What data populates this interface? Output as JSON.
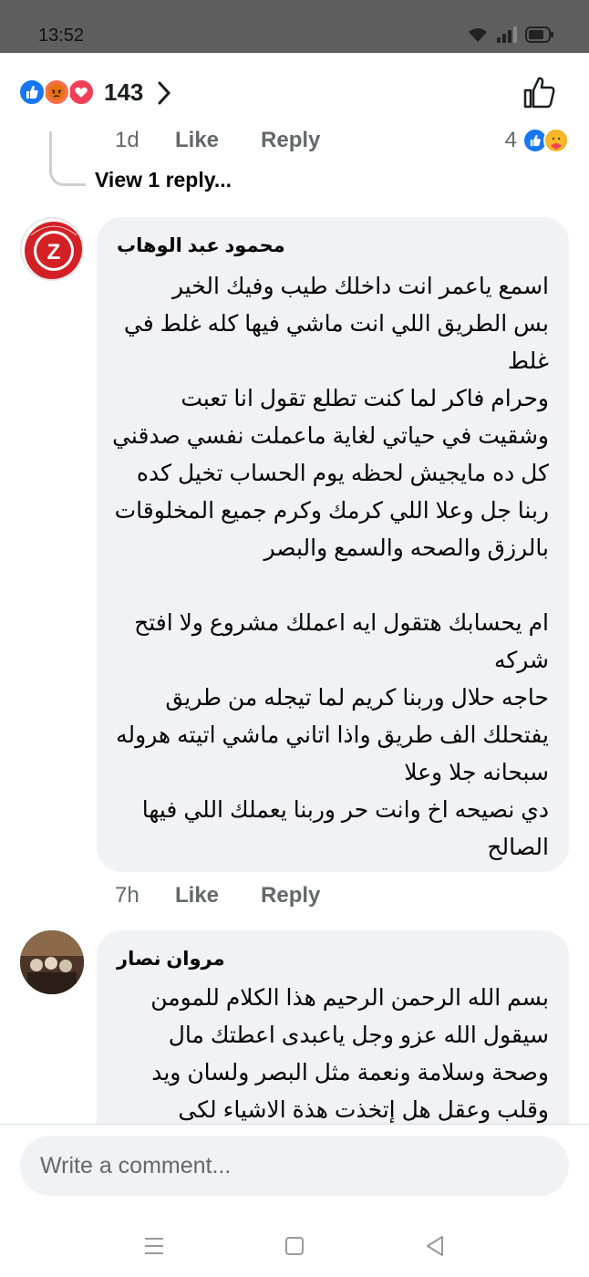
{
  "status_bar": {
    "time": "13:52",
    "icons": [
      "wifi-icon",
      "signal-icon",
      "battery-icon"
    ]
  },
  "reactions": {
    "types": [
      "like",
      "angry",
      "love"
    ],
    "count": "143"
  },
  "previous_comment": {
    "time": "1d",
    "like_label": "Like",
    "reply_label": "Reply",
    "reaction_count": "4",
    "view_replies": "View 1 reply..."
  },
  "comments": [
    {
      "author": "محمود عبد الوهاب",
      "lines": [
        "اسمع ياعمر انت داخلك طيب وفيك الخير",
        "بس الطريق اللي انت ماشي فيها كله غلط في",
        "غلط",
        "وحرام فاكر لما كنت تطلع تقول انا تعبت",
        "وشقيت في حياتي لغاية ماعملت نفسي صدقني",
        "كل ده مايجيش لحظه يوم الحساب تخيل كده",
        "ربنا جل وعلا اللي كرمك وكرم جميع المخلوقات",
        "بالرزق والصحه والسمع والبصر",
        "",
        "ام يحسابك هتقول ايه اعملك مشروع ولا افتح",
        "شركه",
        "حاجه حلال وربنا كريم لما تيجله من طريق",
        "يفتحلك الف طريق واذا اتاني ماشي اتيته هروله",
        "سبحانه جلا وعلا",
        "دي نصيحه اخ وانت حر وربنا يعملك اللي فيها",
        "الصالح"
      ],
      "time": "7h",
      "like_label": "Like",
      "reply_label": "Reply"
    },
    {
      "author": "مروان نصار",
      "lines": [
        "بسم الله الرحمن الرحيم هذا الكلام للمومن",
        "سيقول الله عزو وجل ياعبدى اعطتك مال",
        "وصحة وسلامة ونعمة مثل البصر ولسان ويد",
        "وقلب وعقل هل إتخذت هذة الاشياء لكى"
      ]
    }
  ],
  "composer": {
    "placeholder": "Write a comment..."
  },
  "colors": {
    "like_blue": "#1877f2",
    "angry_orange": "#f7714c",
    "love_red": "#f33e58",
    "bubble_bg": "#f0f2f5",
    "meta_gray": "#65676b"
  }
}
